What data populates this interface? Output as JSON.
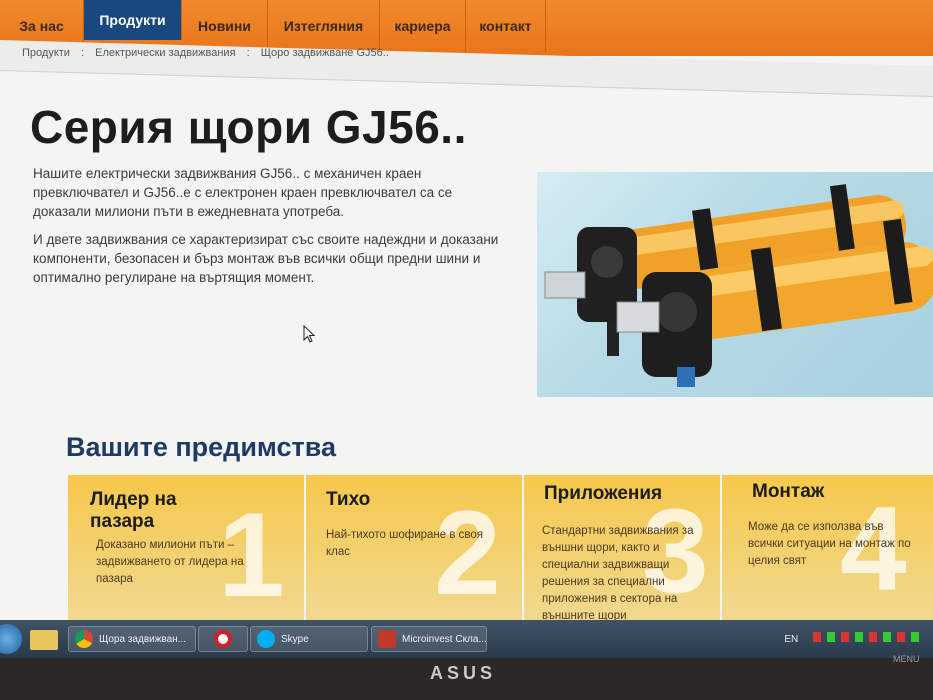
{
  "nav": {
    "tabs": [
      {
        "label": "За нас"
      },
      {
        "label": "Продукти"
      },
      {
        "label": "Новини"
      },
      {
        "label": "Изтегляния"
      },
      {
        "label": "кариера"
      },
      {
        "label": "контакт"
      }
    ],
    "active_index": 1,
    "colors": {
      "bar": "#ec7e22",
      "active": "#19477f"
    }
  },
  "breadcrumb": [
    "Продукти",
    ":",
    "Електрически задвижвания",
    ":",
    "Щоро задвижване GJ56.."
  ],
  "page": {
    "title": "Серия щори GJ56..",
    "intro_1": "Нашите електрически задвижвания GJ56.. с механичен краен превключвател и GJ56..е с електронен краен превключвател са се доказали милиони пъти в ежедневната употреба.",
    "intro_2": "И двете задвижвания се характеризират със своите надеждни и доказани компоненти, безопасен и бърз монтаж във всички общи предни шини и оптимално регулиране на въртящия момент."
  },
  "advantages": {
    "heading": "Вашите предимства",
    "cards": [
      {
        "number": "1",
        "title": "Лидер на пазара",
        "text": "Доказано милиони пъти – задвижването от лидера на пазара"
      },
      {
        "number": "2",
        "title": "Тихо",
        "text": "Най-тихото шофиране в своя клас"
      },
      {
        "number": "3",
        "title": "Приложения",
        "text": "Стандартни задвижвания за външни щори, както и специални задвижващи решения за специални приложения в сектора на външните щори"
      },
      {
        "number": "4",
        "title": "Монтаж",
        "text": "Може да се използва във всички ситуации на монтаж по целия свят"
      }
    ]
  },
  "taskbar": {
    "items": [
      {
        "label": "Щора задвижван...",
        "icon": "chrome-icon"
      },
      {
        "label": "",
        "icon": "opera-icon"
      },
      {
        "label": "Skype",
        "icon": "skype-icon"
      },
      {
        "label": "Microinvest Скла...",
        "icon": "microinvest-icon"
      }
    ],
    "language": "EN"
  },
  "monitor": {
    "brand": "ASUS",
    "menu_label": "MENU"
  }
}
